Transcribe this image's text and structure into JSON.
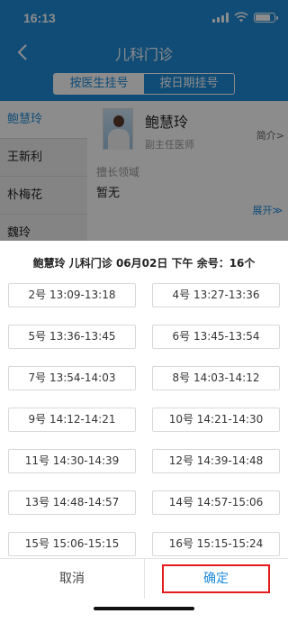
{
  "status": {
    "time": "16:13"
  },
  "nav": {
    "title": "儿科门诊"
  },
  "segment": {
    "tabs": [
      "按医生挂号",
      "按日期挂号"
    ],
    "active": 0
  },
  "doctors": [
    "鲍慧玲",
    "王新利",
    "朴梅花",
    "魏玲"
  ],
  "doctor_detail": {
    "name": "鲍慧玲",
    "title": "副主任医师",
    "intro_link": "简介>",
    "specialty_label": "擅长领域",
    "specialty_value": "暂无",
    "expand_label": "展开≫"
  },
  "modal": {
    "title": "鲍慧玲  儿科门诊  06月02日  下午    余号：16个",
    "slots": [
      "2号  13:09-13:18",
      "4号  13:27-13:36",
      "5号  13:36-13:45",
      "6号  13:45-13:54",
      "7号  13:54-14:03",
      "8号  14:03-14:12",
      "9号  14:12-14:21",
      "10号  14:21-14:30",
      "11号  14:30-14:39",
      "12号  14:39-14:48",
      "13号  14:48-14:57",
      "14号  14:57-15:06",
      "15号  15:06-15:15",
      "16号  15:15-15:24"
    ],
    "cancel_label": "取消",
    "confirm_label": "确定"
  },
  "colors": {
    "brand": "#1e8ad8",
    "highlight": "#e31b1b"
  }
}
